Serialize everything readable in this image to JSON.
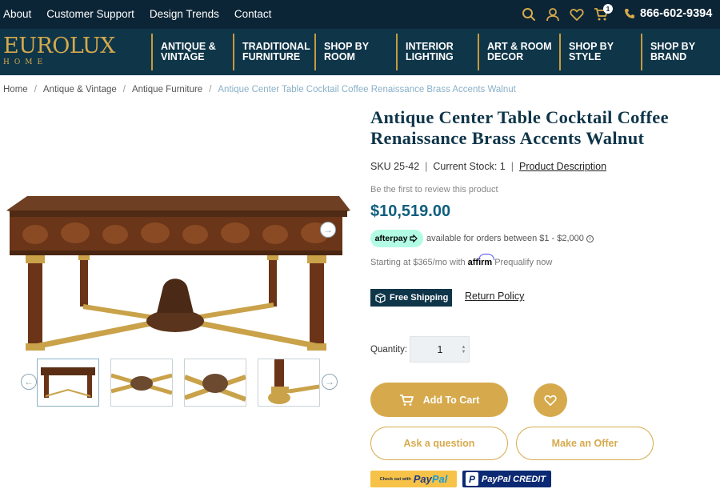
{
  "top_bar": {
    "links": [
      "About",
      "Customer Support",
      "Design Trends",
      "Contact"
    ],
    "cart_count": "1",
    "phone": "866-602-9394"
  },
  "brand": {
    "logo_main": "EUROLUX",
    "logo_sub": "HOME"
  },
  "nav": {
    "items": [
      "ANTIQUE &\nVINTAGE",
      "TRADITIONAL\nFURNITURE",
      "SHOP BY\nROOM",
      "INTERIOR\nLIGHTING",
      "ART & ROOM\nDECOR",
      "SHOP BY\nSTYLE",
      "SHOP BY\nBRAND"
    ]
  },
  "breadcrumb": {
    "items": [
      "Home",
      "Antique & Vintage",
      "Antique Furniture"
    ],
    "current": "Antique Center Table Cocktail Coffee Renaissance Brass Accents Walnut"
  },
  "product": {
    "title": "Antique Center Table Cocktail Coffee Renaissance Brass Accents Walnut",
    "sku": "SKU 25-42",
    "stock": "Current Stock: 1",
    "description_link": "Product Description",
    "review_prompt": "Be the first to review this product",
    "price": "$10,519.00",
    "afterpay_logo": "afterpay",
    "afterpay_text": "available for orders between $1 - $2,000",
    "affirm_prefix": "Starting at $365/mo with",
    "affirm_logo": "affirm",
    "affirm_suffix": "Prequalify now",
    "free_shipping": "Free Shipping",
    "return_policy": "Return Policy",
    "quantity_label": "Quantity:",
    "quantity_value": "1"
  },
  "actions": {
    "add_to_cart": "Add To Cart",
    "ask_question": "Ask a question",
    "make_offer": "Make an Offer",
    "paypal_checkout": "Check out with",
    "paypal_pay": "Pay",
    "paypal_pal": "Pal",
    "paypal_credit_logo": "P",
    "paypal_credit": "PayPal CREDIT"
  },
  "colors": {
    "top_bar": "#0c2536",
    "nav_bar": "#0f3549",
    "gold": "#d6aa4c",
    "price": "#0f5e7e",
    "afterpay": "#b2fce4"
  }
}
